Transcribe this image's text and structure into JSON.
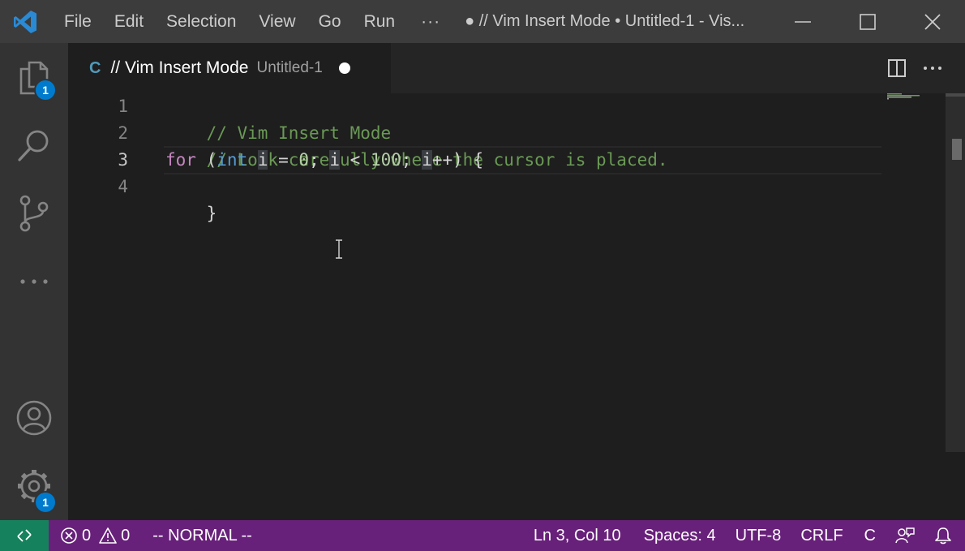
{
  "titlebar": {
    "menu": [
      "File",
      "Edit",
      "Selection",
      "View",
      "Go",
      "Run"
    ],
    "more": "···",
    "window_title": "● // Vim Insert Mode • Untitled-1 - Vis...",
    "icons": [
      "vscode-logo",
      "minimize-icon",
      "maximize-icon",
      "close-icon"
    ]
  },
  "activitybar": {
    "items": [
      {
        "name": "explorer",
        "icon": "files-icon",
        "badge": "1"
      },
      {
        "name": "search",
        "icon": "search-icon"
      },
      {
        "name": "source-control",
        "icon": "source-control-icon"
      },
      {
        "name": "more",
        "icon": "ellipsis-icon"
      },
      {
        "name": "accounts",
        "icon": "account-icon"
      },
      {
        "name": "manage",
        "icon": "gear-icon",
        "badge": "1"
      }
    ]
  },
  "tabs": [
    {
      "lang": "C",
      "title": "// Vim Insert Mode",
      "description": "Untitled-1",
      "dirty": true
    }
  ],
  "tab_actions": [
    "split-editor-icon",
    "more-actions-icon"
  ],
  "editor": {
    "line_numbers": [
      "1",
      "2",
      "3",
      "4"
    ],
    "lines": [
      {
        "comment": "// Vim Insert Mode"
      },
      {
        "comment": "// Look carefully where the cursor is placed."
      },
      {
        "kw_for": "for",
        "p1": " (",
        "kw_int": "int",
        "sp1": " ",
        "v1": "i",
        "p2": " = ",
        "n0": "0",
        "p3": "; ",
        "v2": "i",
        "p4": " < ",
        "n100": "100",
        "p5": "; ",
        "v3": "i",
        "p6": "++) {"
      },
      {
        "text": "}"
      }
    ],
    "active_line": 3
  },
  "statusbar": {
    "errors": "0",
    "warnings": "0",
    "mode": "-- NORMAL --",
    "position": "Ln 3, Col 10",
    "spaces": "Spaces: 4",
    "encoding": "UTF-8",
    "eol": "CRLF",
    "language": "C",
    "colors": {
      "background": "#68217a",
      "remote": "#16825d"
    }
  }
}
